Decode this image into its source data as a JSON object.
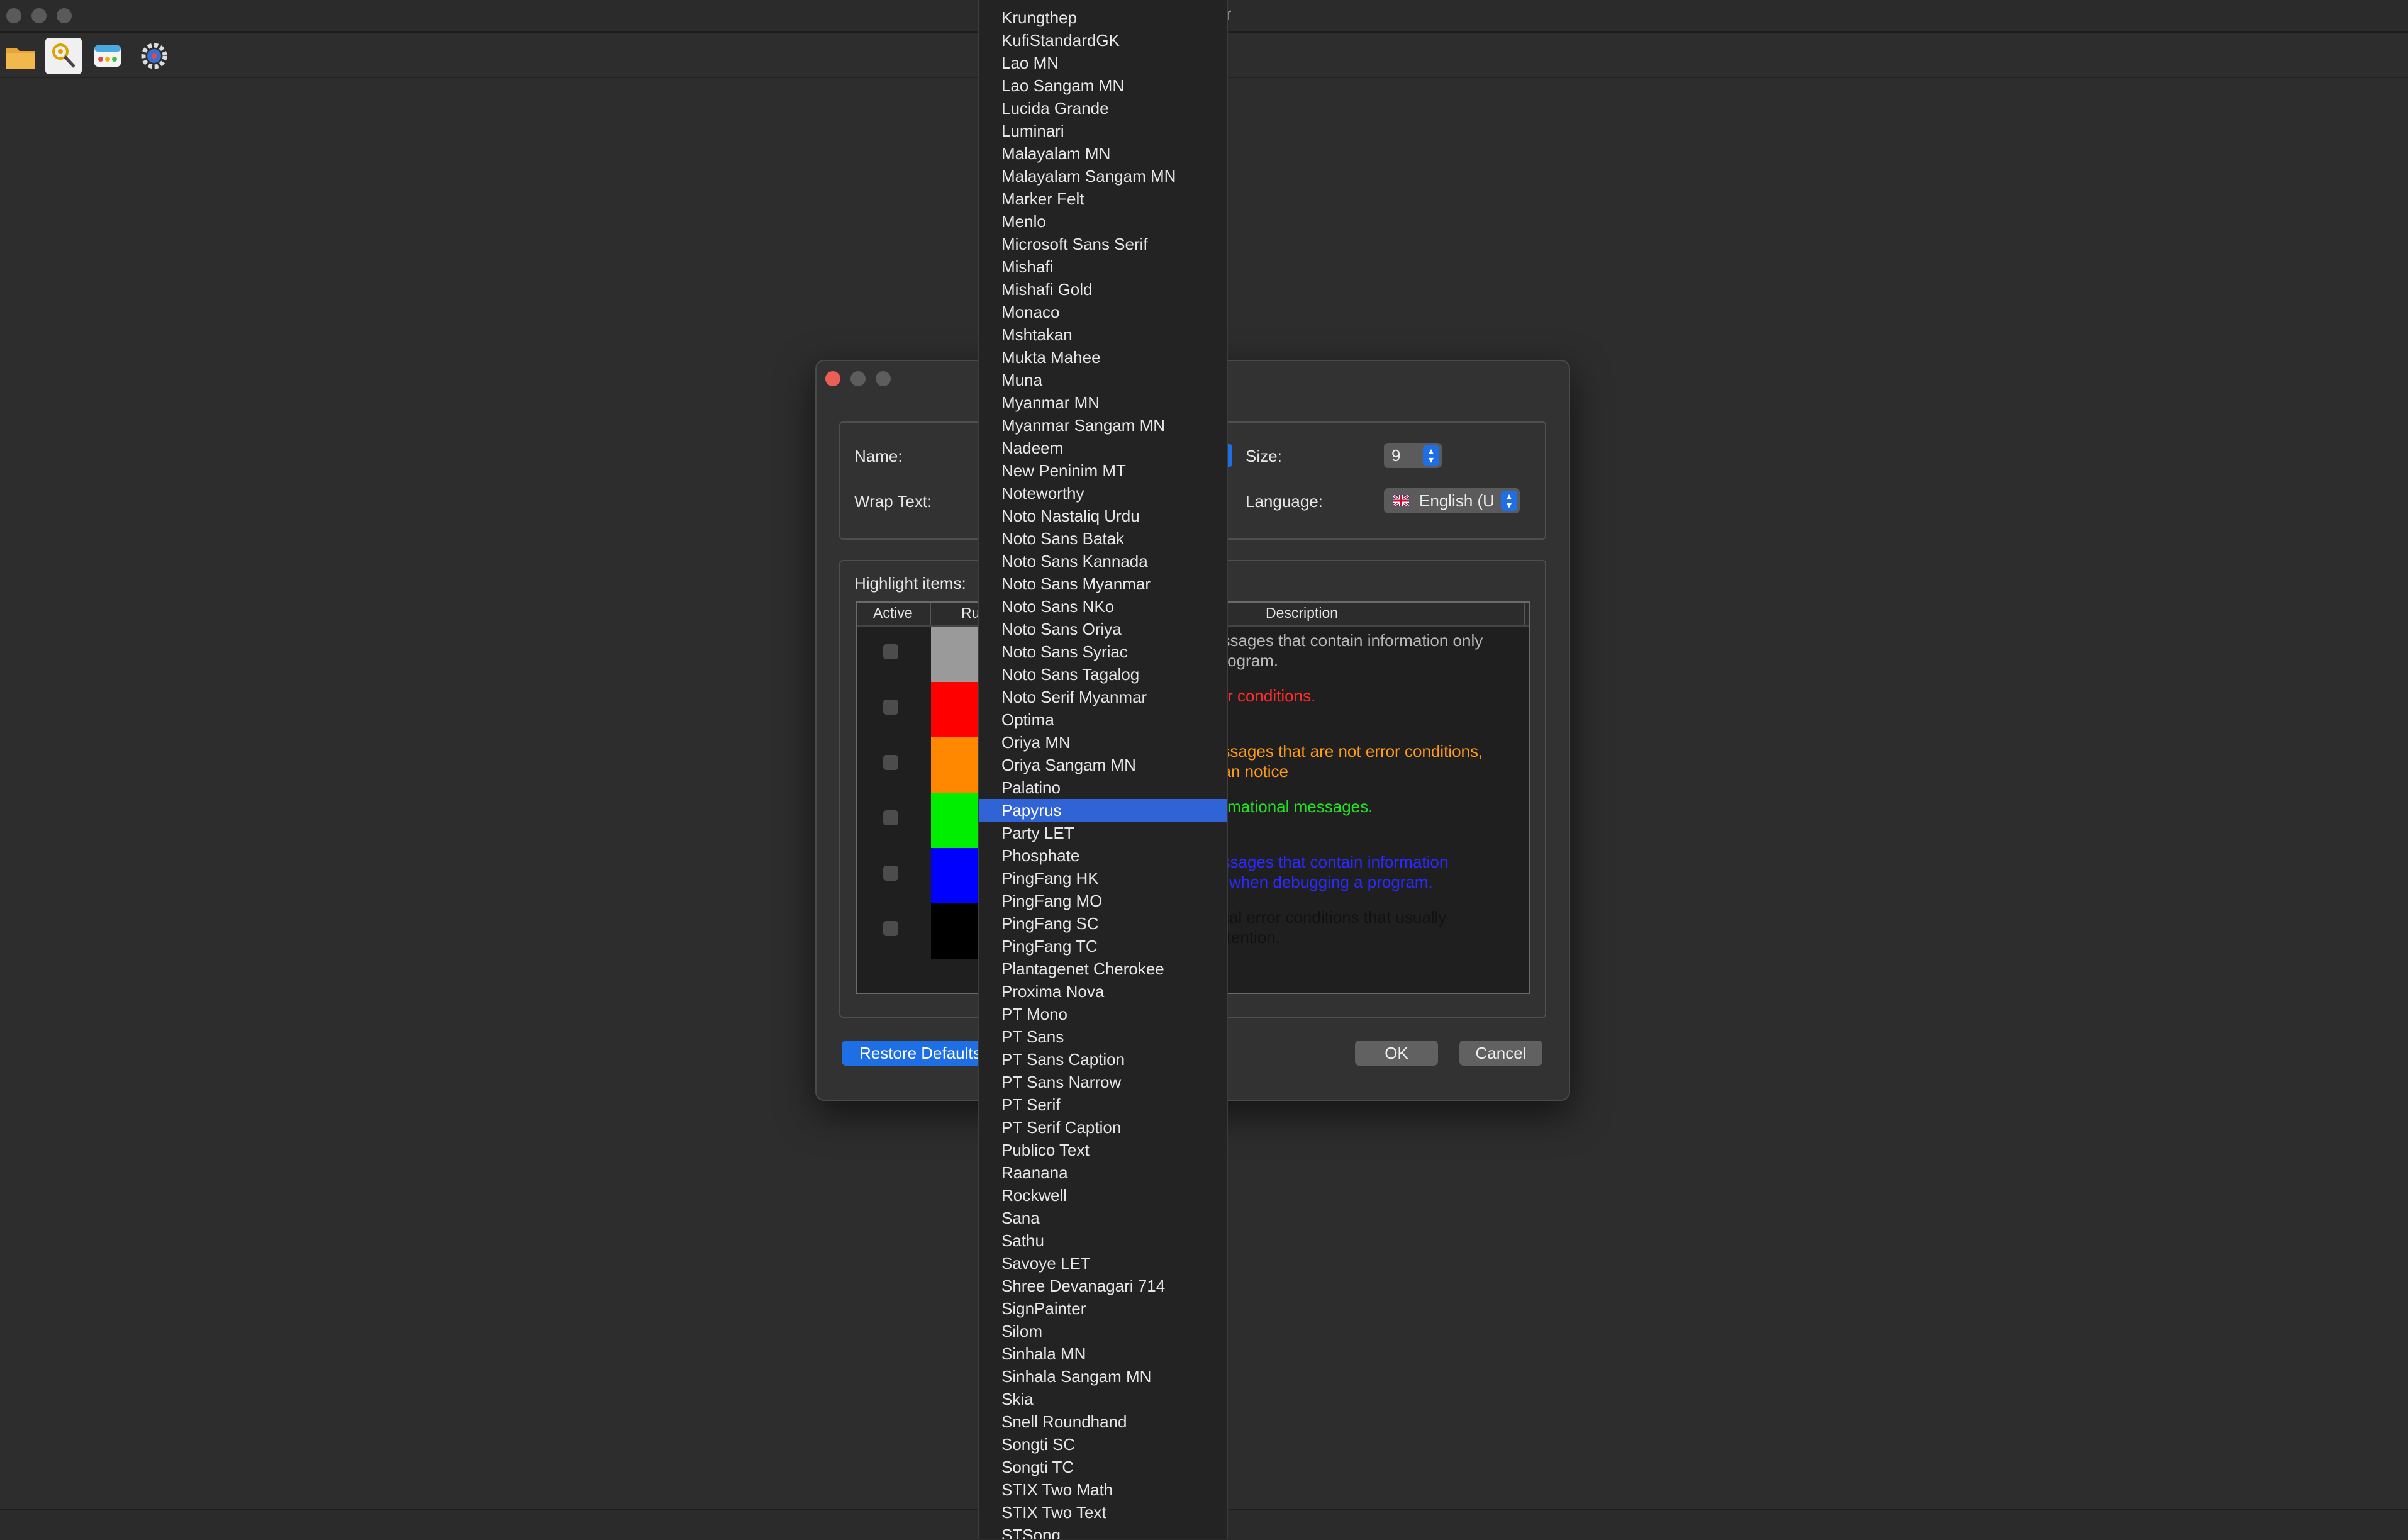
{
  "window": {
    "title": "ver"
  },
  "toolbar": {
    "buttons": [
      {
        "icon": "folder-icon"
      },
      {
        "icon": "search-settings-icon"
      },
      {
        "icon": "color-palette-icon"
      },
      {
        "icon": "gear-icon"
      }
    ]
  },
  "dialog": {
    "name_label": "Name:",
    "wrap_label": "Wrap Text:",
    "size_label": "Size:",
    "size_value": "9",
    "language_label": "Language:",
    "language_value": "English (U",
    "highlight_label": "Highlight items:",
    "table": {
      "headers": {
        "active": "Active",
        "rule": "Ru",
        "description": "Description"
      },
      "rows": [
        {
          "color": "#9a9a9a",
          "desc": "essages that contain information only\n program.",
          "desc_color": "#b8b8b8"
        },
        {
          "color": "#ff0000",
          "desc": "ror conditions.",
          "desc_color": "#ff2a2a"
        },
        {
          "color": "#ff8800",
          "desc": "essages that are not error conditions,\nhan notice",
          "desc_color": "#ff9a1a"
        },
        {
          "color": "#00ee00",
          "desc": "ormational messages.",
          "desc_color": "#22e022"
        },
        {
          "color": "#0000ff",
          "desc": "essages that contain information\nly when debugging a program.",
          "desc_color": "#2a2aff"
        },
        {
          "color": "#000000",
          "desc": "tical error conditions that usually\n attention.",
          "desc_color": "#111111"
        }
      ]
    },
    "restore_label": "Restore Defaults",
    "ok_label": "OK",
    "cancel_label": "Cancel"
  },
  "font_dropdown": {
    "selected": "Papyrus",
    "items": [
      "Krungthep",
      "KufiStandardGK",
      "Lao MN",
      "Lao Sangam MN",
      "Lucida Grande",
      "Luminari",
      "Malayalam MN",
      "Malayalam Sangam MN",
      "Marker Felt",
      "Menlo",
      "Microsoft Sans Serif",
      "Mishafi",
      "Mishafi Gold",
      "Monaco",
      "Mshtakan",
      "Mukta Mahee",
      "Muna",
      "Myanmar MN",
      "Myanmar Sangam MN",
      "Nadeem",
      "New Peninim MT",
      "Noteworthy",
      "Noto Nastaliq Urdu",
      "Noto Sans Batak",
      "Noto Sans Kannada",
      "Noto Sans Myanmar",
      "Noto Sans NKo",
      "Noto Sans Oriya",
      "Noto Sans Syriac",
      "Noto Sans Tagalog",
      "Noto Serif Myanmar",
      "Optima",
      "Oriya MN",
      "Oriya Sangam MN",
      "Palatino",
      "Papyrus",
      "Party LET",
      "Phosphate",
      "PingFang HK",
      "PingFang MO",
      "PingFang SC",
      "PingFang TC",
      "Plantagenet Cherokee",
      "Proxima Nova",
      "PT Mono",
      "PT Sans",
      "PT Sans Caption",
      "PT Sans Narrow",
      "PT Serif",
      "PT Serif Caption",
      "Publico Text",
      "Raanana",
      "Rockwell",
      "Sana",
      "Sathu",
      "Savoye LET",
      "Shree Devanagari 714",
      "SignPainter",
      "Silom",
      "Sinhala MN",
      "Sinhala Sangam MN",
      "Skia",
      "Snell Roundhand",
      "Songti SC",
      "Songti TC",
      "STIX Two Math",
      "STIX Two Text",
      "STSong"
    ]
  }
}
